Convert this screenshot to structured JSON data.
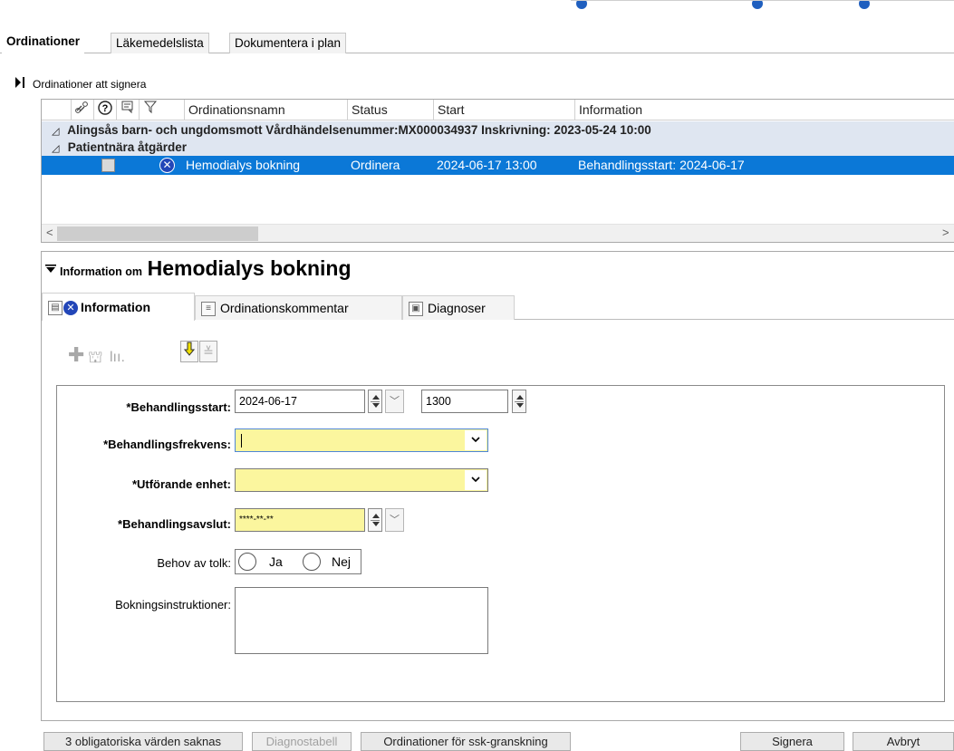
{
  "main_tabs": [
    "Ordinationer",
    "Läkemedelslista",
    "Dokumentera i plan"
  ],
  "section": {
    "toggle_icon": "expand-right-icon",
    "title": "Ordinationer att signera"
  },
  "grid": {
    "icon_columns": [
      "link-icon",
      "help-icon",
      "comment-icon",
      "filter-icon"
    ],
    "columns": [
      "Ordinationsnamn",
      "Status",
      "Start",
      "Information"
    ],
    "group_rows": [
      "Alingsås barn- och ungdomsmott  Vårdhändelsenummer:MX000034937  Inskrivning: 2023-05-24 10:00",
      "Patientnära åtgärder"
    ],
    "selected_row": {
      "name": "Hemodialys bokning",
      "status": "Ordinera",
      "start": "2024-06-17 13:00",
      "information": "Behandlingsstart: 2024-06-17"
    }
  },
  "panel": {
    "small_title": "Information om",
    "big_title": "Hemodialys bokning",
    "tabs": [
      "Information",
      "Ordinationskommentar",
      "Diagnoser"
    ]
  },
  "form": {
    "behandlingsstart_label": "*Behandlingsstart:",
    "behandlingsstart_date": "2024-06-17",
    "behandlingsstart_time": "1300",
    "frekvens_label": "*Behandlingsfrekvens:",
    "frekvens_value": "",
    "enhet_label": "*Utförande enhet:",
    "enhet_value": "",
    "avslut_label": "*Behandlingsavslut:",
    "avslut_placeholder": "****-**-**",
    "tolk_label": "Behov av tolk:",
    "tolk_options": [
      "Ja",
      "Nej"
    ],
    "instruktioner_label": "Bokningsinstruktioner:",
    "instruktioner_value": ""
  },
  "bottom_buttons": {
    "missing": "3 obligatoriska värden saknas",
    "diagnostabell": "Diagnostabell",
    "ssk": "Ordinationer för ssk-granskning",
    "signera": "Signera",
    "avbryt": "Avbryt"
  },
  "colors": {
    "selection": "#0b78d7",
    "required_field": "#fbf69e",
    "group_row": "#dfe6f1"
  }
}
